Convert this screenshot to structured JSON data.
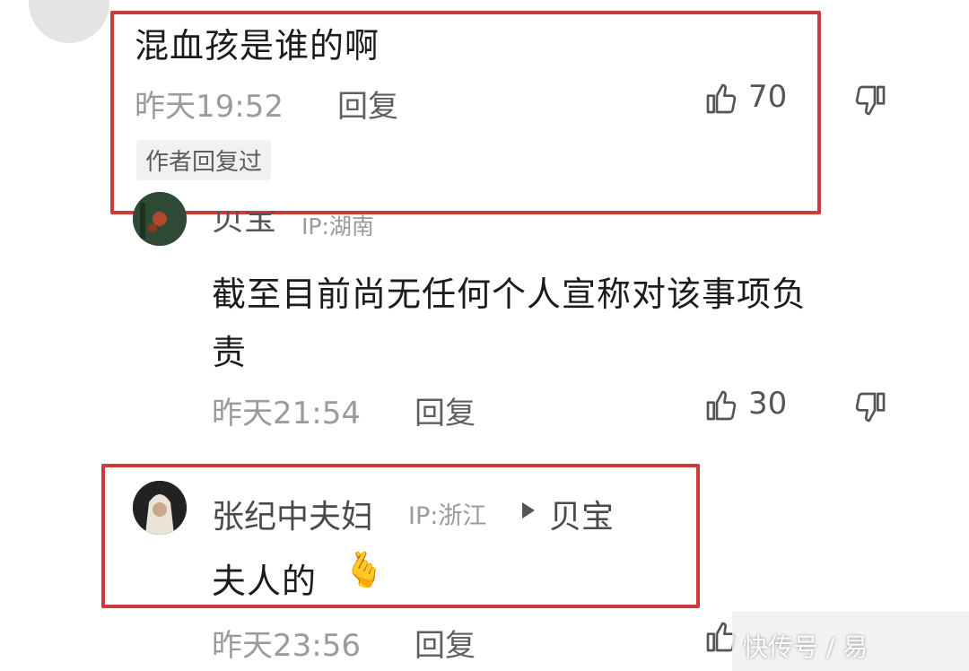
{
  "comments": [
    {
      "text": "混血孩是谁的啊",
      "time": "昨天19:52",
      "reply_label": "回复",
      "likes": "70",
      "author_replied_badge": "作者回复过"
    },
    {
      "username": "贝宝",
      "ip": "IP:湖南",
      "text_line1": "截至目前尚无任何个人宣称对该事项负",
      "text_line2": "责",
      "time": "昨天21:54",
      "reply_label": "回复",
      "likes": "30"
    },
    {
      "username": "张纪中夫妇",
      "ip": "IP:浙江",
      "reply_to": "贝宝",
      "text": "夫人的",
      "emoji": "🫰",
      "time": "昨天23:56",
      "reply_label": "回复"
    }
  ],
  "watermark": "快传号 / 易",
  "colors": {
    "highlight_box": "#cc3b3b",
    "muted_text": "#9b9b9b"
  },
  "icons": [
    "thumbs-up-icon",
    "thumbs-down-icon",
    "reply-arrow-icon"
  ]
}
